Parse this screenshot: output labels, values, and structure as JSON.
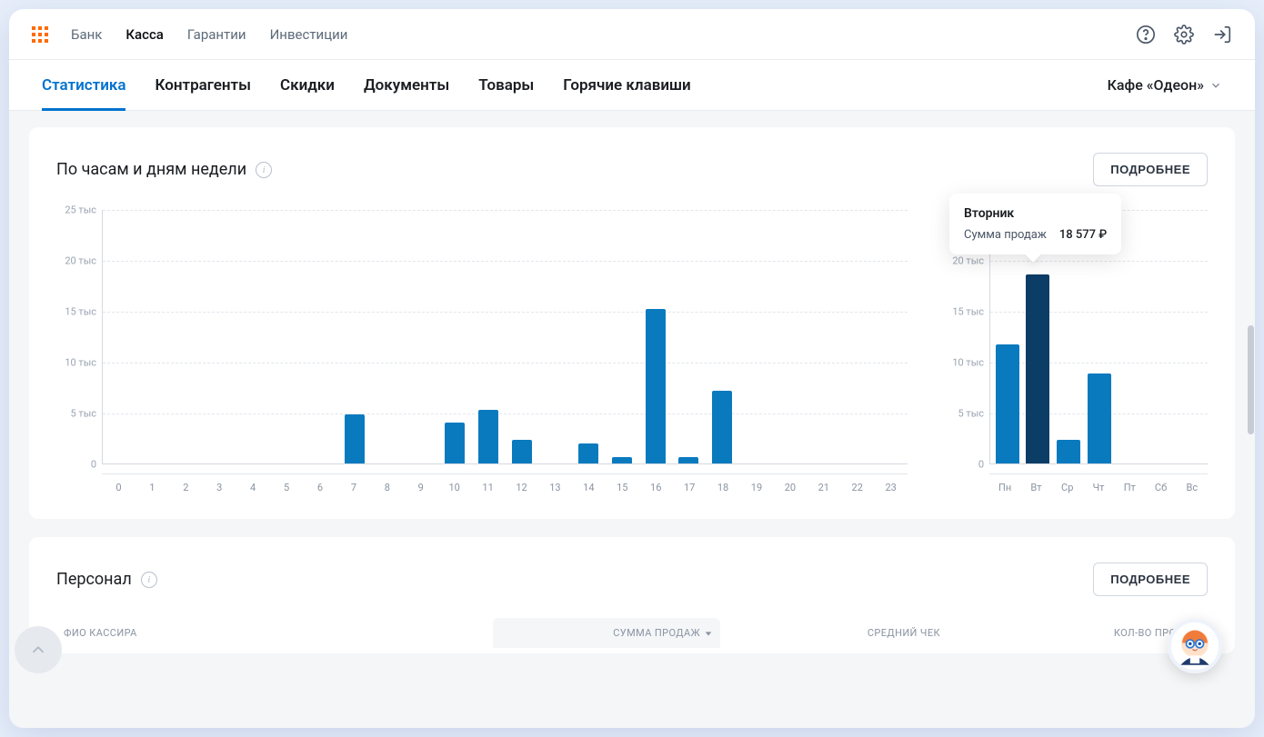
{
  "topnav": {
    "items": [
      "Банк",
      "Касса",
      "Гарантии",
      "Инвестиции"
    ],
    "active_index": 1
  },
  "subtabs": {
    "items": [
      "Статистика",
      "Контрагенты",
      "Скидки",
      "Документы",
      "Товары",
      "Горячие клавиши"
    ],
    "active_index": 0
  },
  "org_selector": "Кафе «Одеон»",
  "card_hours": {
    "title": "По часам и дням недели",
    "details_btn": "ПОДРОБНЕЕ"
  },
  "card_personnel": {
    "title": "Персонал",
    "details_btn": "ПОДРОБНЕЕ",
    "columns": {
      "name": "ФИО КАССИРА",
      "sum": "СУММА ПРОДАЖ",
      "avg": "СРЕДНИЙ ЧЕК",
      "qty": "КОЛ-ВО ПРОДАЖ"
    }
  },
  "tooltip": {
    "title": "Вторник",
    "label": "Сумма продаж",
    "value": "18 577 ₽"
  },
  "chart_data": [
    {
      "type": "bar",
      "id": "by_hour",
      "categories": [
        "0",
        "1",
        "2",
        "3",
        "4",
        "5",
        "6",
        "7",
        "8",
        "9",
        "10",
        "11",
        "12",
        "13",
        "14",
        "15",
        "16",
        "17",
        "18",
        "19",
        "20",
        "21",
        "22",
        "23"
      ],
      "values": [
        0,
        0,
        0,
        0,
        0,
        0,
        0,
        4800,
        0,
        0,
        4000,
        5300,
        2300,
        0,
        2000,
        600,
        15200,
        600,
        7100,
        0,
        0,
        0,
        0,
        0
      ],
      "ylabel_suffix": " тыс",
      "y_ticks": [
        0,
        5000,
        10000,
        15000,
        20000,
        25000
      ],
      "y_tick_labels": [
        "0",
        "5 тыс",
        "10 тыс",
        "15 тыс",
        "20 тыс",
        "25 тыс"
      ],
      "ylim": [
        0,
        25000
      ]
    },
    {
      "type": "bar",
      "id": "by_weekday",
      "categories": [
        "Пн",
        "Вт",
        "Ср",
        "Чт",
        "Пт",
        "Сб",
        "Вс"
      ],
      "values": [
        11700,
        18577,
        2300,
        8800,
        0,
        0,
        0
      ],
      "highlight_index": 1,
      "y_ticks": [
        0,
        5000,
        10000,
        15000,
        20000,
        25000
      ],
      "y_tick_labels": [
        "0",
        "5 тыс",
        "10 тыс",
        "15 тыс",
        "20 тыс",
        "25 тыс"
      ],
      "ylim": [
        0,
        25000
      ]
    }
  ],
  "colors": {
    "bar": "#0a7abf",
    "bar_highlight": "#0c3d66",
    "accent": "#0072ce",
    "logo": "#ff6b00"
  }
}
